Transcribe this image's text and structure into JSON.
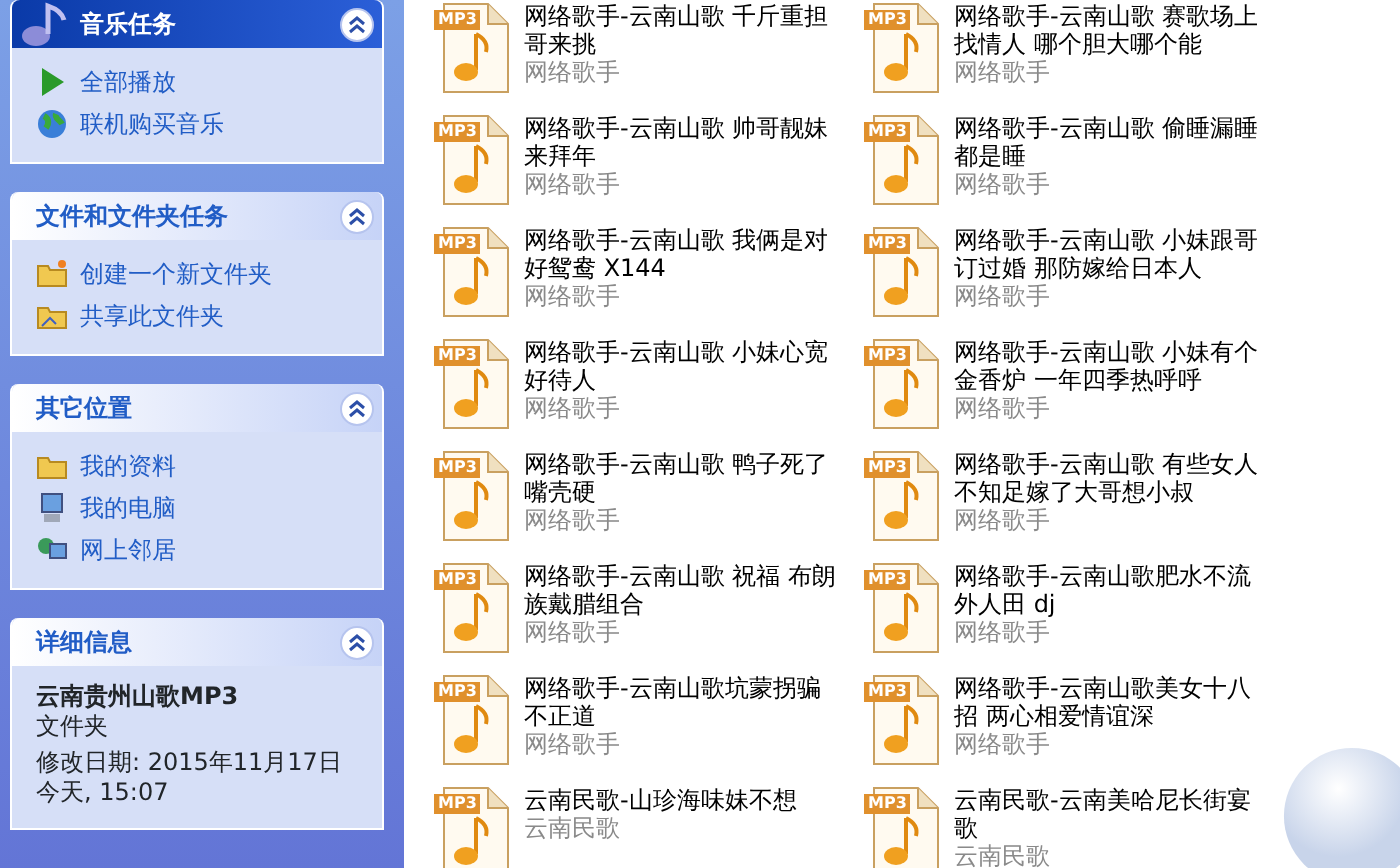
{
  "task_panels": [
    {
      "kind": "special",
      "title": "音乐任务",
      "expanded": true,
      "items": [
        "全部播放",
        "联机购买音乐"
      ]
    },
    {
      "kind": "normal",
      "title": "文件和文件夹任务",
      "expanded": true,
      "items": [
        "创建一个新文件夹",
        "共享此文件夹"
      ]
    },
    {
      "kind": "normal",
      "title": "其它位置",
      "expanded": true,
      "items": [
        "我的资料",
        "我的电脑",
        "网上邻居"
      ]
    }
  ],
  "details": {
    "title": "详细信息",
    "expanded": true,
    "name": "云南贵州山歌MP3",
    "type": "文件夹",
    "modified": "修改日期: 2015年11月17日今天, 15:07"
  },
  "files": [
    {
      "badge": "MP3",
      "title": "网络歌手-云南山歌 千斤重担哥来挑",
      "artist": "网络歌手"
    },
    {
      "badge": "MP3",
      "title": "网络歌手-云南山歌 赛歌场上找情人 哪个胆大哪个能",
      "artist": "网络歌手"
    },
    {
      "badge": "MP3",
      "title": "网络歌手-云南山歌 帅哥靓妹来拜年",
      "artist": "网络歌手"
    },
    {
      "badge": "MP3",
      "title": "网络歌手-云南山歌 偷睡漏睡都是睡",
      "artist": "网络歌手"
    },
    {
      "badge": "MP3",
      "title": "网络歌手-云南山歌 我俩是对好鸳鸯 X144",
      "artist": "网络歌手"
    },
    {
      "badge": "MP3",
      "title": "网络歌手-云南山歌 小妹跟哥订过婚 那防嫁给日本人",
      "artist": "网络歌手"
    },
    {
      "badge": "MP3",
      "title": "网络歌手-云南山歌 小妹心宽好待人",
      "artist": "网络歌手"
    },
    {
      "badge": "MP3",
      "title": "网络歌手-云南山歌 小妹有个金香炉 一年四季热呼呼",
      "artist": "网络歌手"
    },
    {
      "badge": "MP3",
      "title": "网络歌手-云南山歌 鸭子死了嘴壳硬",
      "artist": "网络歌手"
    },
    {
      "badge": "MP3",
      "title": "网络歌手-云南山歌 有些女人不知足嫁了大哥想小叔",
      "artist": "网络歌手"
    },
    {
      "badge": "MP3",
      "title": "网络歌手-云南山歌 祝福 布朗族戴腊组合",
      "artist": "网络歌手"
    },
    {
      "badge": "MP3",
      "title": "网络歌手-云南山歌肥水不流外人田 dj",
      "artist": "网络歌手"
    },
    {
      "badge": "MP3",
      "title": "网络歌手-云南山歌坑蒙拐骗不正道",
      "artist": "网络歌手"
    },
    {
      "badge": "MP3",
      "title": "网络歌手-云南山歌美女十八招 两心相爱情谊深",
      "artist": "网络歌手"
    },
    {
      "badge": "MP3",
      "title": "云南民歌-山珍海味妹不想",
      "artist": "云南民歌"
    },
    {
      "badge": "MP3",
      "title": "云南民歌-云南美哈尼长街宴歌",
      "artist": "云南民歌"
    }
  ]
}
